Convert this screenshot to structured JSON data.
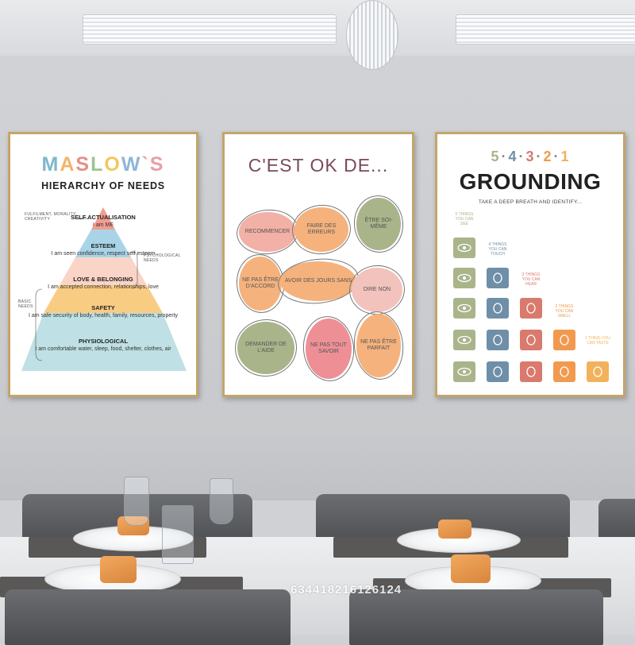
{
  "poster_maslow": {
    "title_letters": [
      {
        "ch": "M",
        "color": "#7fb7c9"
      },
      {
        "ch": "A",
        "color": "#f2b56a"
      },
      {
        "ch": "S",
        "color": "#e58f86"
      },
      {
        "ch": "L",
        "color": "#9cc48f"
      },
      {
        "ch": "O",
        "color": "#f1c75e"
      },
      {
        "ch": "W",
        "color": "#8fb6d8"
      },
      {
        "ch": "`",
        "color": "#e6a0a6"
      },
      {
        "ch": "S",
        "color": "#e6a0a6"
      }
    ],
    "subtitle": "HIERARCHY OF NEEDS",
    "tiers": [
      {
        "name": "SELF ACTUALISATION",
        "text": "I am ME",
        "color": "#f29d8e"
      },
      {
        "name": "ESTEEM",
        "text": "I am seen confidence, respect self esteem",
        "color": "#a9d4e8"
      },
      {
        "name": "LOVE & BELONGING",
        "text": "I am accepted connection, relationships, love",
        "color": "#fad4c6"
      },
      {
        "name": "SAFETY",
        "text": "I am safe security of body, health, family, resources, property",
        "color": "#f9cc83"
      },
      {
        "name": "PHYSIOLOGICAL",
        "text": "I am comfortable water, sleep, food, shelter, clothes, air",
        "color": "#bfe0e4"
      }
    ],
    "notes": {
      "fulfilment": "FULFILMENT, MORALITY, CREATIVITY",
      "psychological": "PSYCHOLOGICAL NEEDS",
      "basic": "BASIC NEEDS"
    }
  },
  "poster_cest": {
    "title": "C'EST OK DE...",
    "blobs": [
      {
        "text": "RECOMMENCER",
        "color": "#f2b0a6"
      },
      {
        "text": "FAIRE DES ERREURS",
        "color": "#f5b27d"
      },
      {
        "text": "ÊTRE SOI-MÊME",
        "color": "#a9b48a"
      },
      {
        "text": "NE PAS ÊTRE D'ACCORD",
        "color": "#f5b27d"
      },
      {
        "text": "AVOIR DES JOURS SANS",
        "color": "#f5b27d"
      },
      {
        "text": "DIRE NON",
        "color": "#f2c2bd"
      },
      {
        "text": "DEMANDER DE L'AIDE",
        "color": "#a9b48a"
      },
      {
        "text": "NE PAS TOUT SAVOIR",
        "color": "#ee8f96"
      },
      {
        "text": "NE PAS ÊTRE PARFAIT",
        "color": "#f5b27d"
      }
    ]
  },
  "poster_grounding": {
    "numbers": [
      {
        "ch": "5",
        "color": "#a9b48a"
      },
      {
        "ch": "·",
        "color": "#888"
      },
      {
        "ch": "4",
        "color": "#6f8fa8"
      },
      {
        "ch": "·",
        "color": "#888"
      },
      {
        "ch": "3",
        "color": "#d97a6d"
      },
      {
        "ch": "·",
        "color": "#888"
      },
      {
        "ch": "2",
        "color": "#f19a4f"
      },
      {
        "ch": "·",
        "color": "#888"
      },
      {
        "ch": "1",
        "color": "#f2b25b"
      }
    ],
    "title": "GROUNDING",
    "subtitle": "TAKE A DEEP BREATH AND IDENTIFY...",
    "labels": [
      {
        "text": "5 THINGS YOU CAN SEE",
        "color": "#a9b48a"
      },
      {
        "text": "4 THINGS YOU CAN TOUCH",
        "color": "#6f8fa8"
      },
      {
        "text": "3 THINGS YOU CAN HEAR",
        "color": "#d97a6d"
      },
      {
        "text": "2 THINGS YOU CAN SMELL",
        "color": "#f19a4f"
      },
      {
        "text": "1 THING YOU CAN TASTE",
        "color": "#f2b25b"
      }
    ],
    "tile_colors": {
      "see": "#a9b48a",
      "touch": "#6f8fa8",
      "hear": "#d97a6d",
      "smell": "#f19a4f",
      "taste": "#f2b25b"
    }
  },
  "watermark": "634418216126124"
}
